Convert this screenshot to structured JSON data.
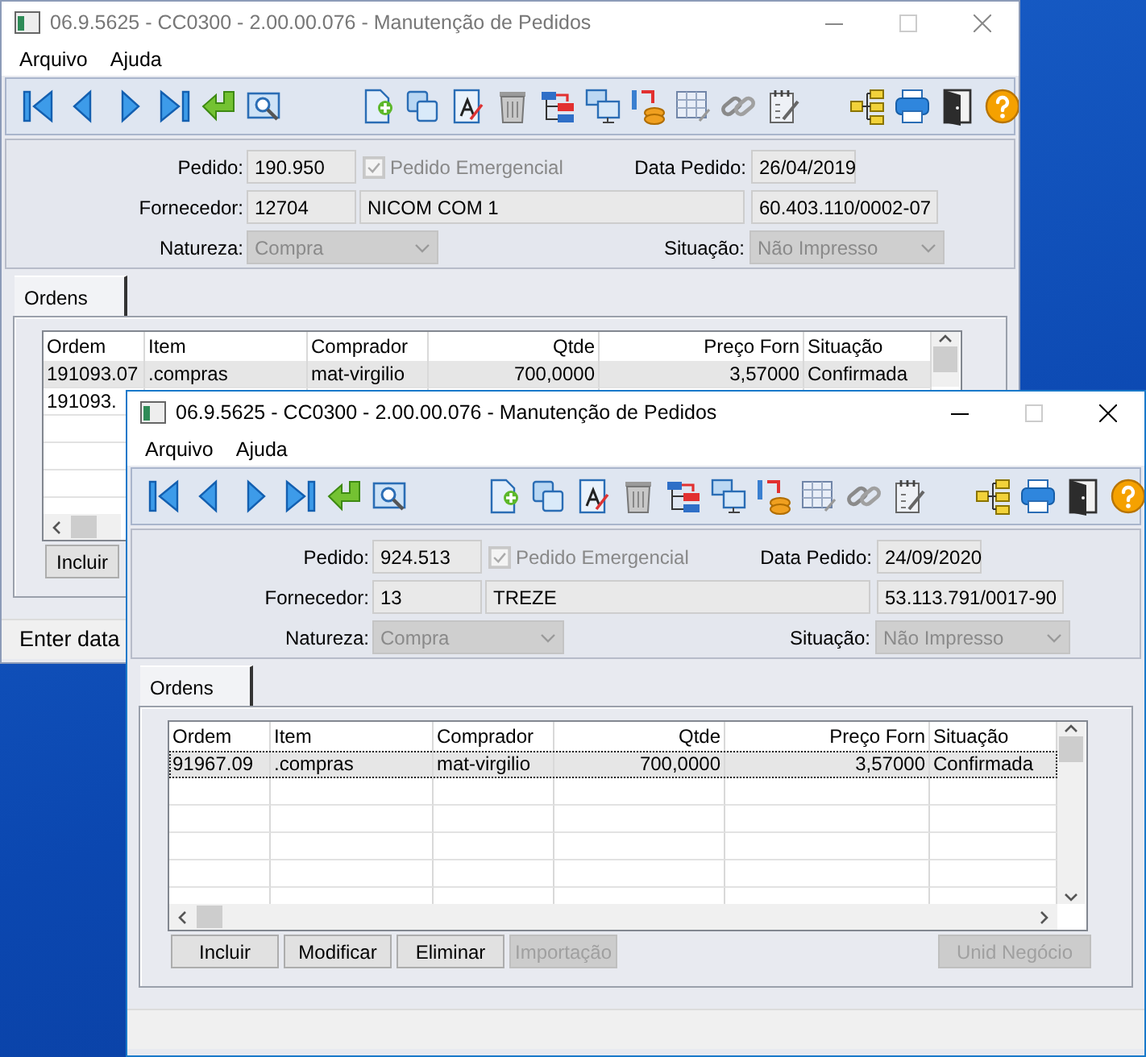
{
  "windows": [
    {
      "title": "06.9.5625 - CC0300 - 2.00.00.076 - Manutenção de Pedidos",
      "active": false,
      "menu": [
        "Arquivo",
        "Ajuda"
      ],
      "form": {
        "pedido_label": "Pedido:",
        "pedido": "190.950",
        "emergencial_label": "Pedido Emergencial",
        "emergencial_checked": true,
        "data_label": "Data Pedido:",
        "data": "26/04/2019",
        "fornecedor_label": "Fornecedor:",
        "fornecedor_code": "12704",
        "fornecedor_name": "NICOM COM 1",
        "cnpj": "60.403.110/0002-07",
        "natureza_label": "Natureza:",
        "natureza": "Compra",
        "situacao_label": "Situação:",
        "situacao": "Não Impresso"
      },
      "tabs": [
        {
          "label": "Ordens",
          "selected": true
        }
      ],
      "table": {
        "columns": [
          {
            "label": "Ordem"
          },
          {
            "label": "Item"
          },
          {
            "label": "Comprador"
          },
          {
            "label": "Qtde"
          },
          {
            "label": "Preço Forn"
          },
          {
            "label": "Situação"
          }
        ],
        "rows": [
          {
            "cells": [
              "191093.07",
              ".compras",
              "mat-virgilio",
              "700,0000",
              "3,57000",
              "Confirmada"
            ],
            "selected": true
          },
          {
            "cells": [
              "191093."
            ],
            "selected": false
          }
        ]
      },
      "buttons": [
        {
          "label": "Incluir",
          "disabled": false
        }
      ],
      "status_bar": "Enter data"
    },
    {
      "title": "06.9.5625 - CC0300 - 2.00.00.076 - Manutenção de Pedidos",
      "active": true,
      "menu": [
        "Arquivo",
        "Ajuda"
      ],
      "form": {
        "pedido_label": "Pedido:",
        "pedido": "924.513",
        "emergencial_label": "Pedido Emergencial",
        "emergencial_checked": true,
        "data_label": "Data Pedido:",
        "data": "24/09/2020",
        "fornecedor_label": "Fornecedor:",
        "fornecedor_code": "13",
        "fornecedor_name": "TREZE",
        "cnpj": "53.113.791/0017-90",
        "natureza_label": "Natureza:",
        "natureza": "Compra",
        "situacao_label": "Situação:",
        "situacao": "Não Impresso"
      },
      "tabs": [
        {
          "label": "Ordens",
          "selected": true
        }
      ],
      "table": {
        "columns": [
          {
            "label": "Ordem"
          },
          {
            "label": "Item"
          },
          {
            "label": "Comprador"
          },
          {
            "label": "Qtde"
          },
          {
            "label": "Preço Forn"
          },
          {
            "label": "Situação"
          }
        ],
        "rows": [
          {
            "cells": [
              "91967.09",
              ".compras",
              "mat-virgilio",
              "700,0000",
              "3,57000",
              "Confirmada"
            ],
            "selected": true
          }
        ]
      },
      "buttons": [
        {
          "label": "Incluir",
          "disabled": false
        },
        {
          "label": "Modificar",
          "disabled": false
        },
        {
          "label": "Eliminar",
          "disabled": false
        },
        {
          "label": "Importação",
          "disabled": true
        }
      ],
      "side_buttons": [
        {
          "label": "Unid Negócio",
          "disabled": true
        }
      ]
    }
  ]
}
